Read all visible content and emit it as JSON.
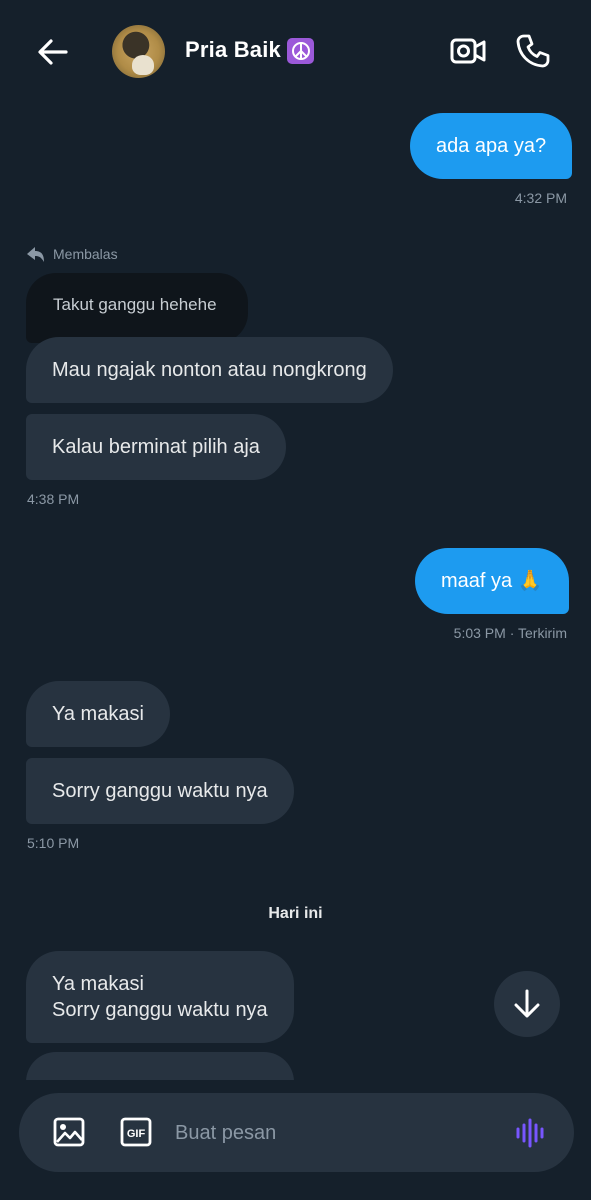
{
  "header": {
    "contact_name": "Pria Baik",
    "badge_icon": "peace-symbol-icon",
    "accent": "#9b59d9"
  },
  "messages": [
    {
      "id": "m1",
      "side": "out",
      "text": "ada apa ya?",
      "time": "4:32 PM"
    },
    {
      "id": "reply_label",
      "text": "Membalas",
      "quoted_text": "Takut ganggu hehehe"
    },
    {
      "id": "m2",
      "side": "in",
      "text": "Mau ngajak nonton atau nongkrong"
    },
    {
      "id": "m3",
      "side": "in",
      "text": "Kalau berminat pilih aja",
      "time": "4:38 PM"
    },
    {
      "id": "m4",
      "side": "out",
      "text": "maaf ya 🙏",
      "time": "5:03 PM · Terkirim"
    },
    {
      "id": "m5",
      "side": "in",
      "text": "Ya makasi"
    },
    {
      "id": "m6",
      "side": "in",
      "text": "Sorry ganggu waktu nya",
      "time": "5:10 PM"
    },
    {
      "id": "m7",
      "side": "in",
      "text_line1": "Ya makasi",
      "text_line2": "Sorry ganggu waktu nya"
    }
  ],
  "date_divider": "Hari ini",
  "composer": {
    "placeholder": "Buat pesan",
    "gif_label": "GIF"
  },
  "colors": {
    "background": "#15202b",
    "outgoing_bubble": "#1d9bf0",
    "incoming_bubble": "#273340",
    "voice_icon": "#7856ff"
  }
}
